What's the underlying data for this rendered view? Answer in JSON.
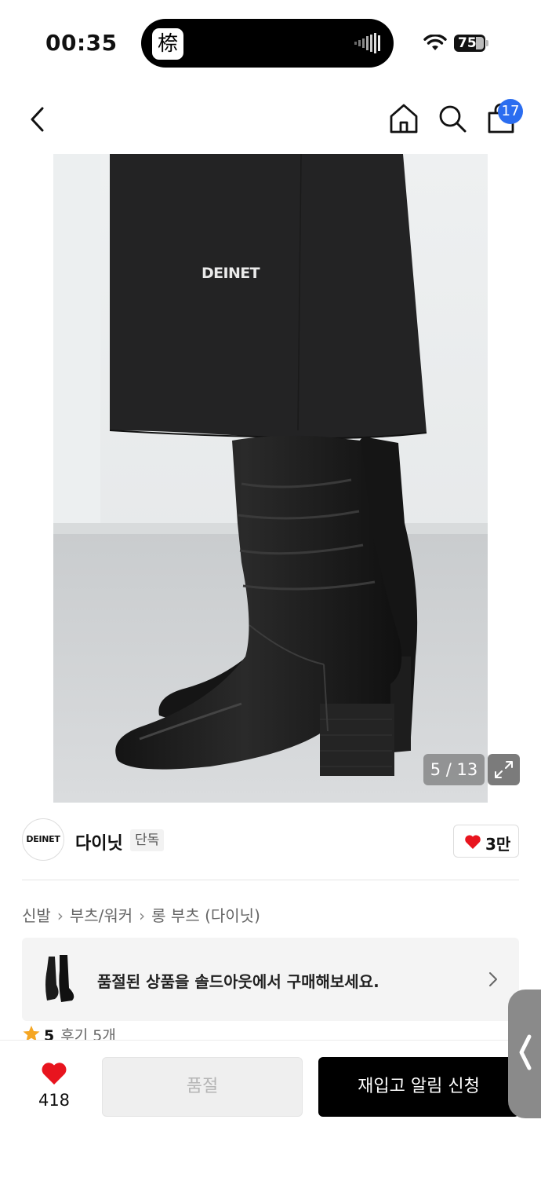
{
  "status_bar": {
    "time": "00:35",
    "battery": "75",
    "island_app_glyph": "㮈"
  },
  "header": {
    "cart_count": "17"
  },
  "gallery": {
    "counter": "5 / 13",
    "print_text": "DEINET"
  },
  "brand": {
    "logo_text": "DEINET",
    "name": "다이닛",
    "tag": "단독",
    "likes": "3만"
  },
  "breadcrumb": [
    "신발",
    "부츠/워커",
    "롱 부츠 (다이닛)"
  ],
  "banner": {
    "text": "품절된 상품을 솔드아웃에서 구매해보세요."
  },
  "rating": {
    "score": "5",
    "reviews": "후기 5개"
  },
  "bottom": {
    "wish_count": "418",
    "soldout_label": "품절",
    "restock_label": "재입고 알림 신청"
  },
  "colors": {
    "accent_blue": "#2b6df0",
    "heart_red": "#e8141e",
    "rating_orange": "#f5a623",
    "primary_button": "#000000"
  },
  "icons": [
    "back-icon",
    "home-icon",
    "search-icon",
    "cart-icon",
    "expand-icon",
    "heart-icon",
    "star-icon",
    "chevron-right-icon",
    "chevron-left-icon"
  ]
}
